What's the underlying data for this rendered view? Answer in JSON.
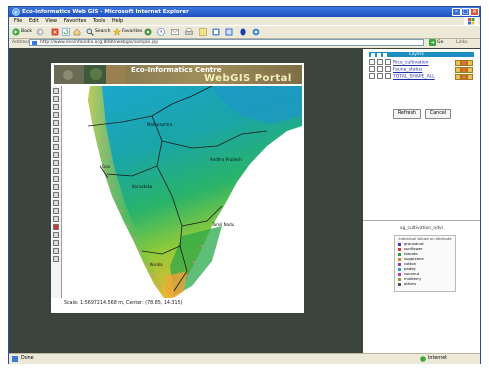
{
  "window": {
    "title": "Eco-Informatics Web GIS - Microsoft Internet Explorer"
  },
  "menu": [
    "File",
    "Edit",
    "View",
    "Favorites",
    "Tools",
    "Help"
  ],
  "toolbar": {
    "back_label": "Back",
    "search_label": "Search",
    "favorites_label": "Favorites"
  },
  "address": {
    "label": "Address",
    "url": "http://www.ecoinfoindia.org:8080/webgis/sample.jsp",
    "go_label": "Go",
    "links_label": "Links"
  },
  "banner": {
    "line1": "Eco-Informatics Centre",
    "line2": "WebGIS Portal"
  },
  "map": {
    "region_labels": [
      "Maharashtra",
      "Goa",
      "Karnataka",
      "Andhra Pradesh",
      "Tamil Nadu",
      "Kerala"
    ],
    "status_text": "Scale: 1:5697214.568 m, Center: (78.85, 14.315)"
  },
  "layers": {
    "header": "Layers",
    "items": [
      {
        "name": "Rice_cultivation"
      },
      {
        "name": "Fauna_status"
      },
      {
        "name": "TOTAL_SHAPE_ALL"
      }
    ]
  },
  "buttons": {
    "refresh": "Refresh",
    "cancel": "Cancel"
  },
  "legend": {
    "title": "sg_cultivation_ndvi",
    "header": "Individual Values on Attribute",
    "items": [
      {
        "label": "groundnut",
        "color": "#3b3bcc"
      },
      {
        "label": "sunflower",
        "color": "#cc3b3b"
      },
      {
        "label": "tomato",
        "color": "#3b9b3b"
      },
      {
        "label": "sugarcane",
        "color": "#cc8a2a"
      },
      {
        "label": "cotton",
        "color": "#8a3bcc"
      },
      {
        "label": "paddy",
        "color": "#2a9bcc"
      },
      {
        "label": "coconut",
        "color": "#cc3b9b"
      },
      {
        "label": "mulberry",
        "color": "#9b9b2a"
      },
      {
        "label": "others",
        "color": "#555555"
      }
    ]
  },
  "status": {
    "left": "Done",
    "zone": "Internet"
  },
  "colors": {
    "title_bar": "#1d4fc0",
    "desktop_bg": "#3b453d",
    "layer_header": "#1c8dc0"
  }
}
